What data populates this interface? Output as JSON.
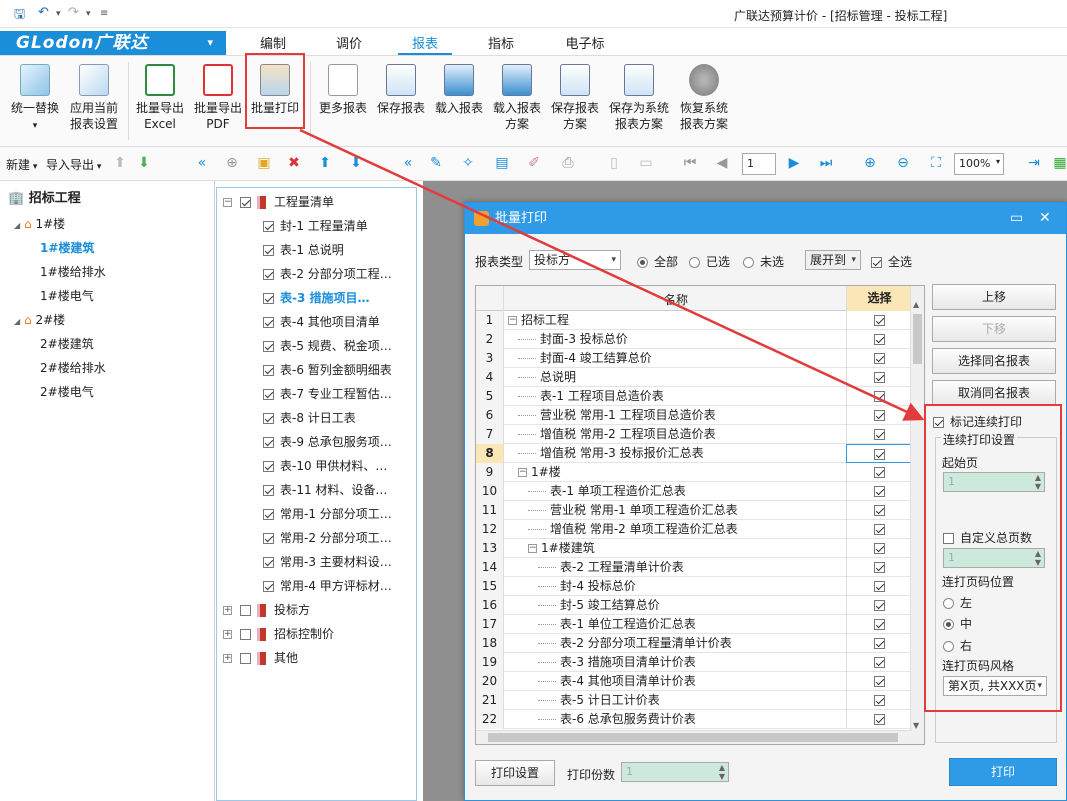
{
  "window": {
    "title": "广联达预算计价 - [招标管理 - 投标工程]"
  },
  "brand": {
    "name": "GLodon广联达",
    "menu_arrow": "▾"
  },
  "tabs": [
    {
      "label": "编制"
    },
    {
      "label": "调价"
    },
    {
      "label": "报表",
      "active": true
    },
    {
      "label": "指标"
    },
    {
      "label": "电子标"
    }
  ],
  "ribbon": {
    "buttons": [
      {
        "label": "统一替换",
        "label2": "▾"
      },
      {
        "label": "应用当前",
        "label2": "报表设置"
      },
      {
        "label": "批量导出",
        "label2": "Excel"
      },
      {
        "label": "批量导出",
        "label2": "PDF"
      },
      {
        "label": "批量打印",
        "label2": ""
      },
      {
        "label": "更多报表",
        "label2": ""
      },
      {
        "label": "保存报表",
        "label2": ""
      },
      {
        "label": "载入报表",
        "label2": ""
      },
      {
        "label": "载入报表",
        "label2": "方案"
      },
      {
        "label": "保存报表",
        "label2": "方案"
      },
      {
        "label": "保存为系统",
        "label2": "报表方案"
      },
      {
        "label": "恢复系统",
        "label2": "报表方案"
      }
    ]
  },
  "subbar": {
    "new_label": "新建",
    "import_export_label": "导入导出",
    "page_value": "1",
    "zoom_value": "100%"
  },
  "left_tree": {
    "root": "招标工程",
    "items": [
      {
        "label": "1#楼",
        "level": 1
      },
      {
        "label": "1#楼建筑",
        "level": 2,
        "current": true
      },
      {
        "label": "1#楼给排水",
        "level": 2
      },
      {
        "label": "1#楼电气",
        "level": 2
      },
      {
        "label": "2#楼",
        "level": 1
      },
      {
        "label": "2#楼建筑",
        "level": 2
      },
      {
        "label": "2#楼给排水",
        "level": 2
      },
      {
        "label": "2#楼电气",
        "level": 2
      }
    ]
  },
  "mid_tree": {
    "root": "工程量清单",
    "items": [
      {
        "label": "封-1 工程量清单"
      },
      {
        "label": "表-1 总说明"
      },
      {
        "label": "表-2 分部分项工程…"
      },
      {
        "label": "表-3 措施项目…",
        "current": true
      },
      {
        "label": "表-4 其他项目清单"
      },
      {
        "label": "表-5 规费、税金项…"
      },
      {
        "label": "表-6 暂列金额明细表"
      },
      {
        "label": "表-7 专业工程暂估…"
      },
      {
        "label": "表-8 计日工表"
      },
      {
        "label": "表-9 总承包服务项…"
      },
      {
        "label": "表-10 甲供材料、…"
      },
      {
        "label": "表-11 材料、设备…"
      },
      {
        "label": "常用-1 分部分项工…"
      },
      {
        "label": "常用-2 分部分项工…"
      },
      {
        "label": "常用-3 主要材料设…"
      },
      {
        "label": "常用-4 甲方评标材…"
      }
    ],
    "groups": [
      "投标方",
      "招标控制价",
      "其他"
    ]
  },
  "dialog": {
    "title": "批量打印",
    "report_type_label": "报表类型",
    "report_type_value": "投标方",
    "filter_all": "全部",
    "filter_selected": "已选",
    "filter_unselected": "未选",
    "expand_label": "展开到",
    "select_all_label": "全选",
    "col_name": "名称",
    "col_select": "选择",
    "rows": [
      {
        "n": "1",
        "name": "招标工程",
        "indent": 0,
        "exp": "−"
      },
      {
        "n": "2",
        "name": "封面-3 投标总价",
        "indent": 1
      },
      {
        "n": "3",
        "name": "封面-4 竣工结算总价",
        "indent": 1
      },
      {
        "n": "4",
        "name": "总说明",
        "indent": 1
      },
      {
        "n": "5",
        "name": "表-1 工程项目总造价表",
        "indent": 1
      },
      {
        "n": "6",
        "name": "营业税 常用-1 工程项目总造价表",
        "indent": 1
      },
      {
        "n": "7",
        "name": "增值税 常用-2 工程项目总造价表",
        "indent": 1
      },
      {
        "n": "8",
        "name": "增值税 常用-3 投标报价汇总表",
        "indent": 1,
        "current": true
      },
      {
        "n": "9",
        "name": "1#楼",
        "indent": 1,
        "exp": "−"
      },
      {
        "n": "10",
        "name": "表-1 单项工程造价汇总表",
        "indent": 2
      },
      {
        "n": "11",
        "name": "营业税 常用-1 单项工程造价汇总表",
        "indent": 2
      },
      {
        "n": "12",
        "name": "增值税 常用-2 单项工程造价汇总表",
        "indent": 2
      },
      {
        "n": "13",
        "name": "1#楼建筑",
        "indent": 2,
        "exp": "−"
      },
      {
        "n": "14",
        "name": "表-2 工程量清单计价表",
        "indent": 3
      },
      {
        "n": "15",
        "name": "封-4 投标总价",
        "indent": 3
      },
      {
        "n": "16",
        "name": "封-5 竣工结算总价",
        "indent": 3
      },
      {
        "n": "17",
        "name": "表-1 单位工程造价汇总表",
        "indent": 3
      },
      {
        "n": "18",
        "name": "表-2 分部分项工程量清单计价表",
        "indent": 3
      },
      {
        "n": "19",
        "name": "表-3 措施项目清单计价表",
        "indent": 3
      },
      {
        "n": "20",
        "name": "表-4 其他项目清单计价表",
        "indent": 3
      },
      {
        "n": "21",
        "name": "表-5 计日工计价表",
        "indent": 3
      },
      {
        "n": "22",
        "name": "表-6 总承包服务费计价表",
        "indent": 3
      }
    ],
    "btn_up": "上移",
    "btn_down": "下移",
    "btn_select_same": "选择同名报表",
    "btn_cancel_same": "取消同名报表",
    "mark_continuous": "标记连续打印",
    "continuous_settings": "连续打印设置",
    "start_page_label": "起始页",
    "start_page_value": "1",
    "custom_total_label": "自定义总页数",
    "custom_total_value": "1",
    "pos_label": "连打页码位置",
    "pos_left": "左",
    "pos_center": "中",
    "pos_right": "右",
    "style_label": "连打页码风格",
    "style_value": "第X页, 共XXX页",
    "print_settings": "打印设置",
    "copies_label": "打印份数",
    "copies_value": "1",
    "print_button": "打印"
  },
  "colors": {
    "accent": "#2f9be6",
    "highlight": "#e23b3b"
  }
}
